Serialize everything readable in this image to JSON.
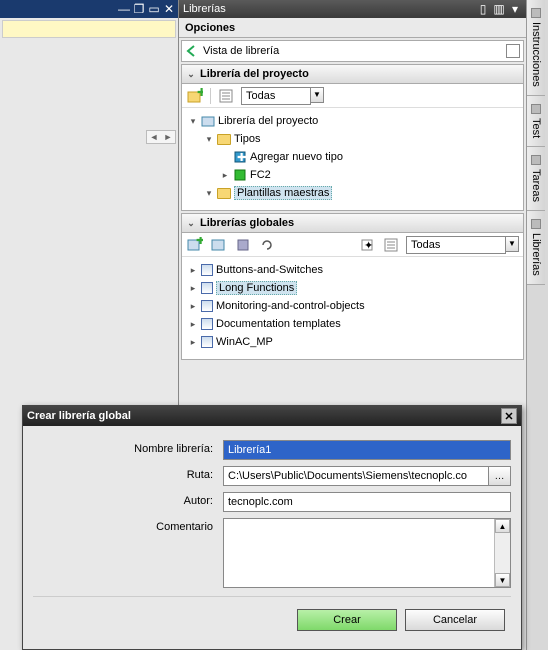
{
  "panel": {
    "title": "Librerías",
    "opciones": "Opciones",
    "vista_label": "Vista de librería"
  },
  "project_lib": {
    "header": "Librería del proyecto",
    "filter": "Todas",
    "root": "Librería del proyecto",
    "tipos": "Tipos",
    "agregar": "Agregar nuevo tipo",
    "fc2": "FC2",
    "plantillas": "Plantillas maestras"
  },
  "global_lib": {
    "header": "Librerías globales",
    "filter": "Todas",
    "items": [
      "Buttons-and-Switches",
      "Long Functions",
      "Monitoring-and-control-objects",
      "Documentation templates",
      "WinAC_MP"
    ]
  },
  "side_tabs": {
    "instrucciones": "Instrucciones",
    "test": "Test",
    "tareas": "Tareas",
    "librerias": "Librerías"
  },
  "dialog": {
    "title": "Crear librería global",
    "nombre_label": "Nombre librería:",
    "nombre_value": "Librería1",
    "ruta_label": "Ruta:",
    "ruta_value": "C:\\Users\\Public\\Documents\\Siemens\\tecnoplc.co",
    "autor_label": "Autor:",
    "autor_value": "tecnoplc.com",
    "comentario_label": "Comentario",
    "crear": "Crear",
    "cancelar": "Cancelar"
  }
}
